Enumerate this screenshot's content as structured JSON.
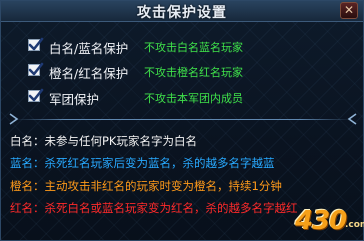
{
  "dialog": {
    "title": "攻击保护设置",
    "close_label": "✕"
  },
  "options": [
    {
      "label": "白名/蓝名保护",
      "description": "不攻击白名蓝名玩家",
      "checked": true
    },
    {
      "label": "橙名/红名保护",
      "description": "不攻击橙名红名玩家",
      "checked": true
    },
    {
      "label": "军团保护",
      "description": "不攻击本军团内成员",
      "checked": true
    }
  ],
  "rules": [
    {
      "text": "白名：未参与任何PK玩家名字为白名",
      "color": "#f3f3f3"
    },
    {
      "text": "蓝名：杀死红名玩家后变为蓝名，杀的越多名字越蓝",
      "color": "#28a9ff"
    },
    {
      "text": "橙名：主动攻击非红名的玩家时变为橙名，持续1分钟",
      "color": "#ff9a1a"
    },
    {
      "text": "红名：杀死白名或蓝名玩家变为红名，杀的越多名字越红",
      "color": "#ff2a2a"
    }
  ],
  "watermark": {
    "main": "430",
    "suffix": ".com"
  },
  "colors": {
    "option_desc": "#3fe24a",
    "title_bar": "#29435f"
  }
}
